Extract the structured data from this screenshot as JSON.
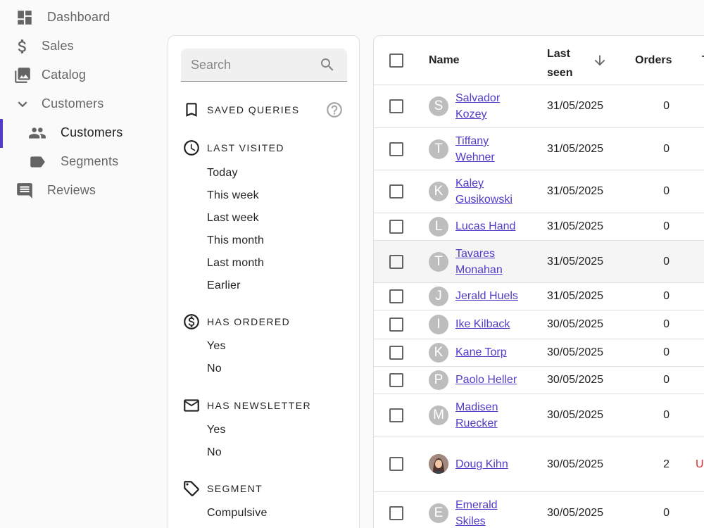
{
  "sidebar": {
    "items": [
      {
        "label": "Dashboard",
        "icon": "dashboard-icon"
      },
      {
        "label": "Sales",
        "icon": "dollar-icon"
      },
      {
        "label": "Catalog",
        "icon": "photo-library-icon"
      },
      {
        "label": "Customers",
        "icon": "chevron-down-icon"
      },
      {
        "label": "Customers",
        "icon": "people-icon"
      },
      {
        "label": "Segments",
        "icon": "label-icon"
      },
      {
        "label": "Reviews",
        "icon": "comment-icon"
      }
    ],
    "accent_color": "#4f3cc9"
  },
  "filters": {
    "search_placeholder": "Search",
    "saved_queries": {
      "title": "SAVED QUERIES"
    },
    "last_visited": {
      "title": "LAST VISITED",
      "options": [
        "Today",
        "This week",
        "Last week",
        "This month",
        "Last month",
        "Earlier"
      ]
    },
    "has_ordered": {
      "title": "HAS ORDERED",
      "options": [
        "Yes",
        "No"
      ]
    },
    "has_newsletter": {
      "title": "HAS NEWSLETTER",
      "options": [
        "Yes",
        "No"
      ]
    },
    "segment": {
      "title": "SEGMENT",
      "options": [
        "Compulsive"
      ]
    }
  },
  "table": {
    "headers": {
      "name": "Name",
      "last_seen": "Last seen",
      "orders": "Orders",
      "spent": "T"
    },
    "rows": [
      {
        "initial": "S",
        "name": "Salvador Kozey",
        "last_seen": "31/05/2025",
        "orders": "0",
        "spent": ""
      },
      {
        "initial": "T",
        "name": "Tiffany Wehner",
        "last_seen": "31/05/2025",
        "orders": "0",
        "spent": ""
      },
      {
        "initial": "K",
        "name": "Kaley Gusikowski",
        "last_seen": "31/05/2025",
        "orders": "0",
        "spent": ""
      },
      {
        "initial": "L",
        "name": "Lucas Hand",
        "last_seen": "31/05/2025",
        "orders": "0",
        "spent": ""
      },
      {
        "initial": "T",
        "name": "Tavares Monahan",
        "last_seen": "31/05/2025",
        "orders": "0",
        "spent": ""
      },
      {
        "initial": "J",
        "name": "Jerald Huels",
        "last_seen": "31/05/2025",
        "orders": "0",
        "spent": ""
      },
      {
        "initial": "I",
        "name": "Ike Kilback",
        "last_seen": "30/05/2025",
        "orders": "0",
        "spent": ""
      },
      {
        "initial": "K",
        "name": "Kane Torp",
        "last_seen": "30/05/2025",
        "orders": "0",
        "spent": ""
      },
      {
        "initial": "P",
        "name": "Paolo Heller",
        "last_seen": "30/05/2025",
        "orders": "0",
        "spent": ""
      },
      {
        "initial": "M",
        "name": "Madisen Ruecker",
        "last_seen": "30/05/2025",
        "orders": "0",
        "spent": ""
      },
      {
        "initial": "",
        "name": "Doug Kihn",
        "last_seen": "30/05/2025",
        "orders": "2",
        "spent": "US"
      },
      {
        "initial": "E",
        "name": "Emerald Skiles",
        "last_seen": "30/05/2025",
        "orders": "0",
        "spent": ""
      }
    ]
  }
}
